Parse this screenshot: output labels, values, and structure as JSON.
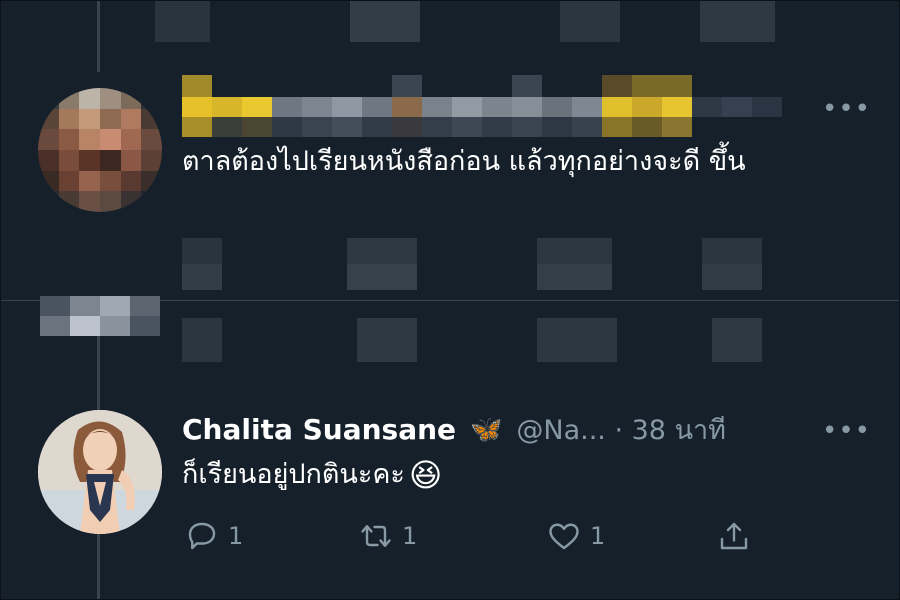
{
  "reply": {
    "text": "ตาลต้องไปเรียนหนังสือก่อน แล้วทุกอย่างจะดี ขึ้น",
    "more_label": "•••"
  },
  "tweet": {
    "display_name": "Chalita Suansane",
    "badge_emoji": "🦋",
    "handle_time": "@Na... · 38 นาที",
    "more_label": "•••",
    "text": "ก็เรียนอยู่ปกตินะคะ",
    "emoji": "😆",
    "reply_count": "1",
    "retweet_count": "1",
    "like_count": "1"
  },
  "colors": {
    "background": "#15202b",
    "secondary_text": "#8899a6",
    "divider": "#38444d"
  },
  "icons": {
    "reply": "reply-icon",
    "retweet": "retweet-icon",
    "like": "heart-icon",
    "share": "share-icon",
    "more": "more-icon"
  }
}
